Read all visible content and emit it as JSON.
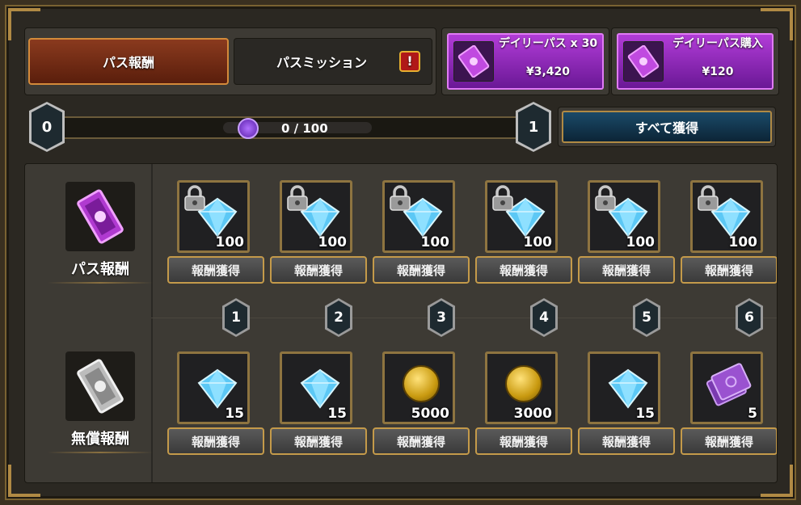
{
  "tabs": {
    "pass_rewards": "パス報酬",
    "pass_mission": "パスミッション",
    "alert": "!"
  },
  "offers": [
    {
      "title": "デイリーパス x 30",
      "price": "¥3,420"
    },
    {
      "title": "デイリーパス購入",
      "price": "¥120"
    }
  ],
  "progress": {
    "start_level": "0",
    "end_level": "1",
    "text": "0 / 100",
    "fraction": 0
  },
  "claim_all_label": "すべて獲得",
  "rows": {
    "pass_label": "パス報酬",
    "free_label": "無償報酬"
  },
  "claim_label": "報酬獲得",
  "levels": [
    "1",
    "2",
    "3",
    "4",
    "5",
    "6"
  ],
  "pass_rewards": [
    {
      "icon": "diamond-icon",
      "qty": "100",
      "locked": true
    },
    {
      "icon": "diamond-icon",
      "qty": "100",
      "locked": true
    },
    {
      "icon": "diamond-icon",
      "qty": "100",
      "locked": true
    },
    {
      "icon": "diamond-icon",
      "qty": "100",
      "locked": true
    },
    {
      "icon": "diamond-icon",
      "qty": "100",
      "locked": true
    },
    {
      "icon": "diamond-icon",
      "qty": "100",
      "locked": true
    }
  ],
  "free_rewards": [
    {
      "icon": "diamond-icon",
      "qty": "15"
    },
    {
      "icon": "diamond-icon",
      "qty": "15"
    },
    {
      "icon": "gold-coin-icon",
      "qty": "5000"
    },
    {
      "icon": "gold-coin-icon",
      "qty": "3000"
    },
    {
      "icon": "diamond-icon",
      "qty": "15"
    },
    {
      "icon": "purple-ticket-icon",
      "qty": "5"
    }
  ],
  "colors": {
    "accent_purple": "#b23cd8",
    "active_tab": "#8a3a1e",
    "gold_border": "#c49a4a"
  }
}
